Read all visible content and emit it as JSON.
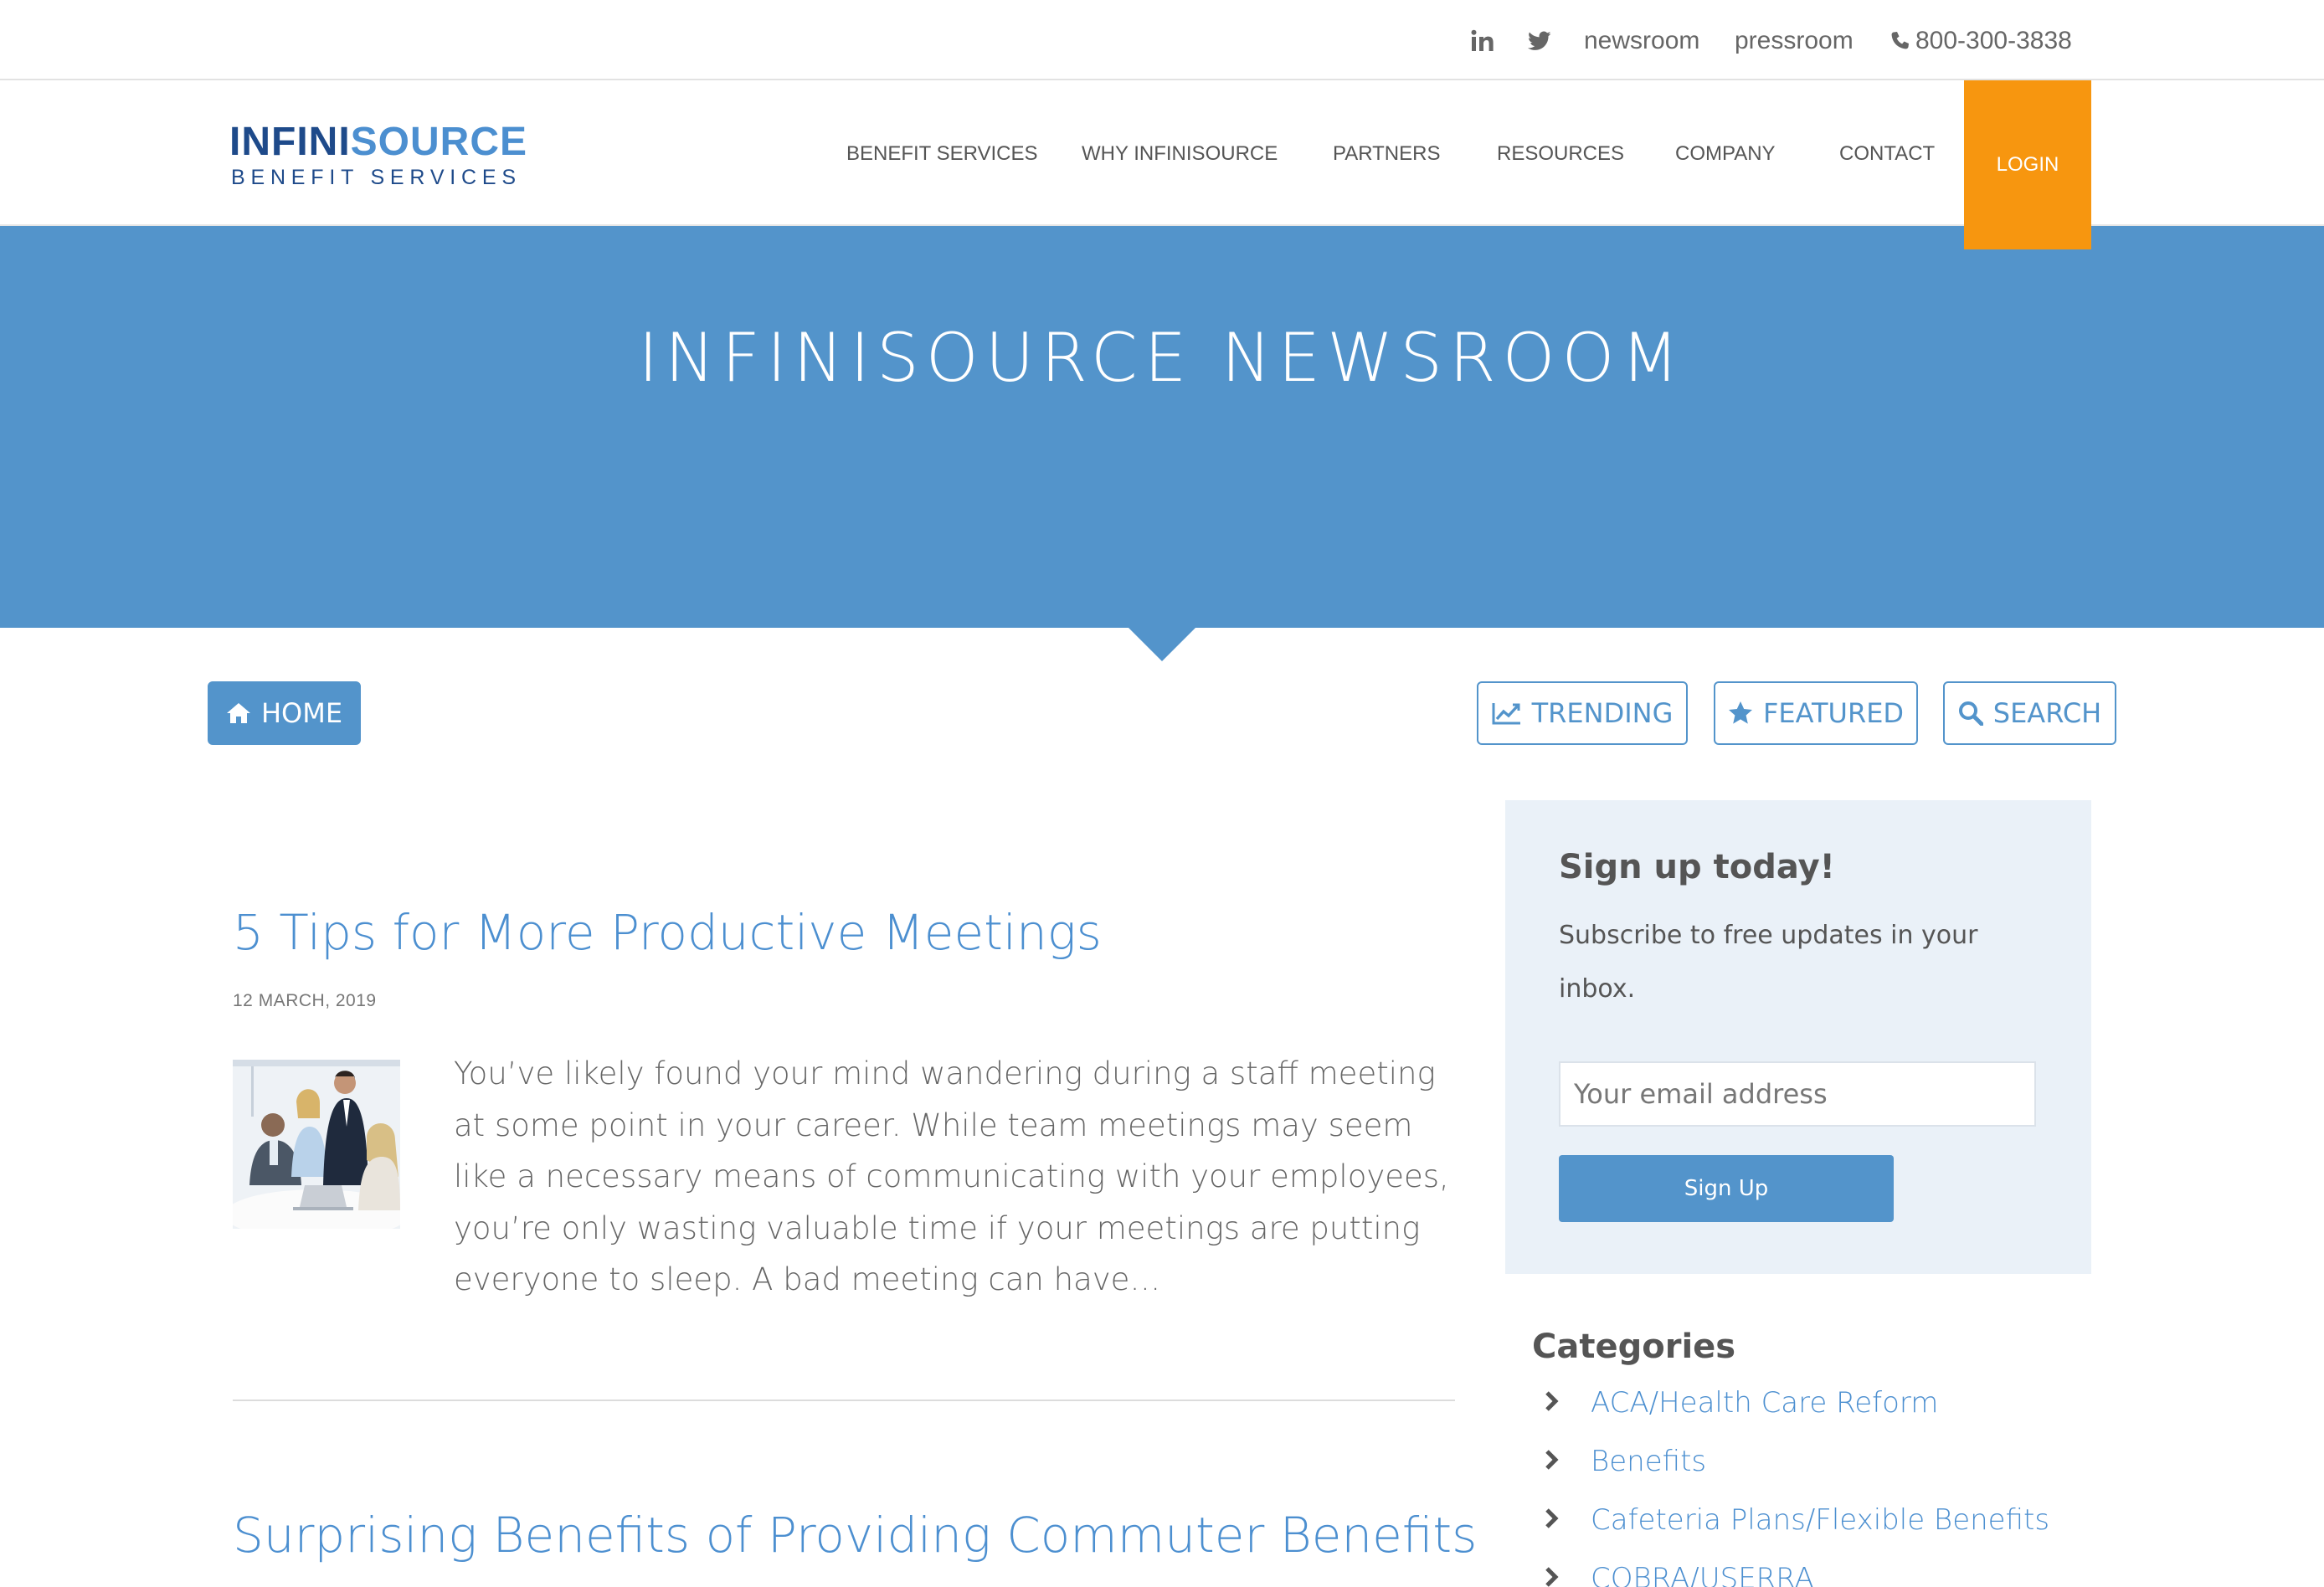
{
  "utility_bar": {
    "newsroom_label": "newsroom",
    "pressroom_label": "pressroom",
    "phone": "800-300-3838",
    "icons": [
      "linkedin-icon",
      "twitter-icon",
      "phone-icon"
    ]
  },
  "header": {
    "logo_primary_1": "INFINI",
    "logo_primary_2": "SOURCE",
    "logo_secondary": "BENEFIT SERVICES",
    "nav": [
      {
        "label": "BENEFIT SERVICES"
      },
      {
        "label": "WHY INFINISOURCE"
      },
      {
        "label": "PARTNERS"
      },
      {
        "label": "RESOURCES"
      },
      {
        "label": "COMPANY"
      },
      {
        "label": "CONTACT"
      }
    ],
    "login_label": "LOGIN"
  },
  "hero": {
    "title": "INFINISOURCE NEWSROOM"
  },
  "filters": {
    "home_label": "HOME",
    "trending_label": "TRENDING",
    "featured_label": "FEATURED",
    "search_label": "SEARCH"
  },
  "articles": [
    {
      "title": "5 Tips for More Productive Meetings",
      "date": "12 MARCH, 2019",
      "excerpt": "You’ve likely found your mind wandering during a staff meeting at some point in your career. While team meetings may seem like a necessary means of communicating with your employees, you’re only wasting valuable time if your meetings are putting everyone to sleep. A bad meeting can have…"
    },
    {
      "title": "Surprising Benefits of Providing Commuter Benefits"
    }
  ],
  "signup": {
    "title": "Sign up today!",
    "text": "Subscribe to free updates in your inbox.",
    "email_placeholder": "Your email address",
    "button_label": "Sign Up"
  },
  "categories": {
    "heading": "Categories",
    "items": [
      {
        "label": "ACA/Health Care Reform"
      },
      {
        "label": "Benefits"
      },
      {
        "label": "Cafeteria Plans/Flexible Benefits"
      },
      {
        "label": "COBRA/USERRA"
      }
    ]
  },
  "colors": {
    "brand_blue": "#5394cb",
    "link_blue": "#4c8fd0",
    "logo_navy": "#1e4a8a",
    "login_orange": "#f7960f",
    "sidebar_bg": "#eaf1f8"
  }
}
